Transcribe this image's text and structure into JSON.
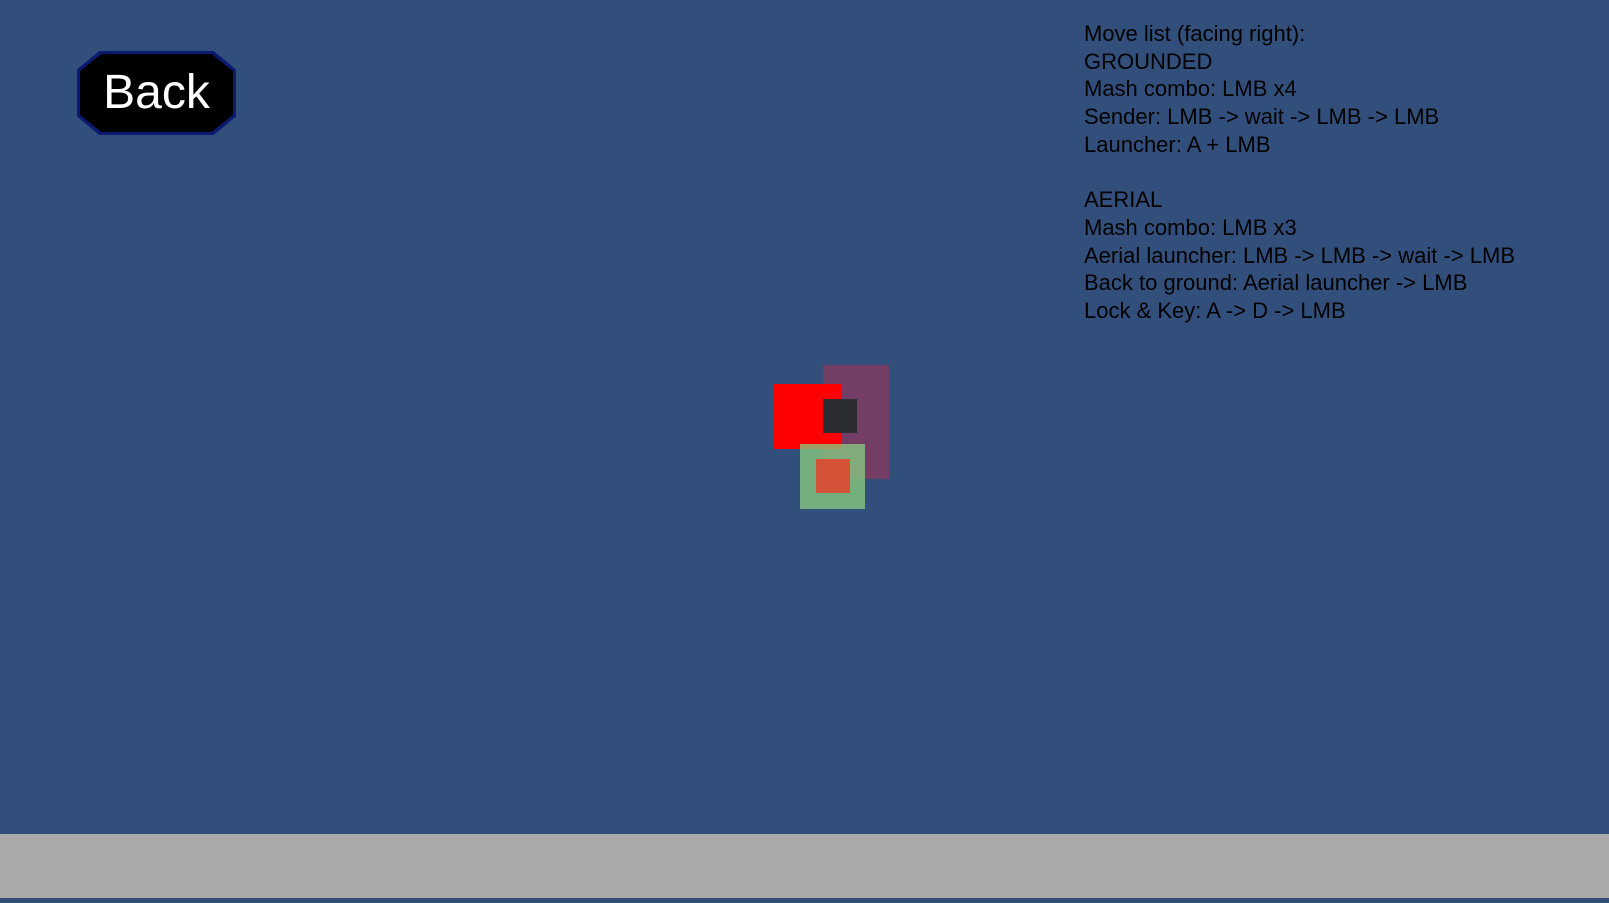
{
  "back_button": {
    "label": "Back"
  },
  "move_list": {
    "heading": "Move list (facing right):",
    "grounded": {
      "title": "GROUNDED",
      "moves": [
        "Mash combo: LMB x4",
        "Sender: LMB -> wait -> LMB -> LMB",
        "Launcher: A + LMB"
      ]
    },
    "aerial": {
      "title": "AERIAL",
      "moves": [
        "Mash combo: LMB x3",
        "Aerial launcher: LMB -> LMB -> wait -> LMB",
        "Back to ground: Aerial launcher -> LMB",
        "Lock & Key: A -> D -> LMB"
      ]
    }
  },
  "colors": {
    "background": "#324f7b",
    "ground": "#aaaaaa",
    "player": "#ff0000",
    "hitbox": "#88c980",
    "hurtbox": "#7a3d62"
  }
}
